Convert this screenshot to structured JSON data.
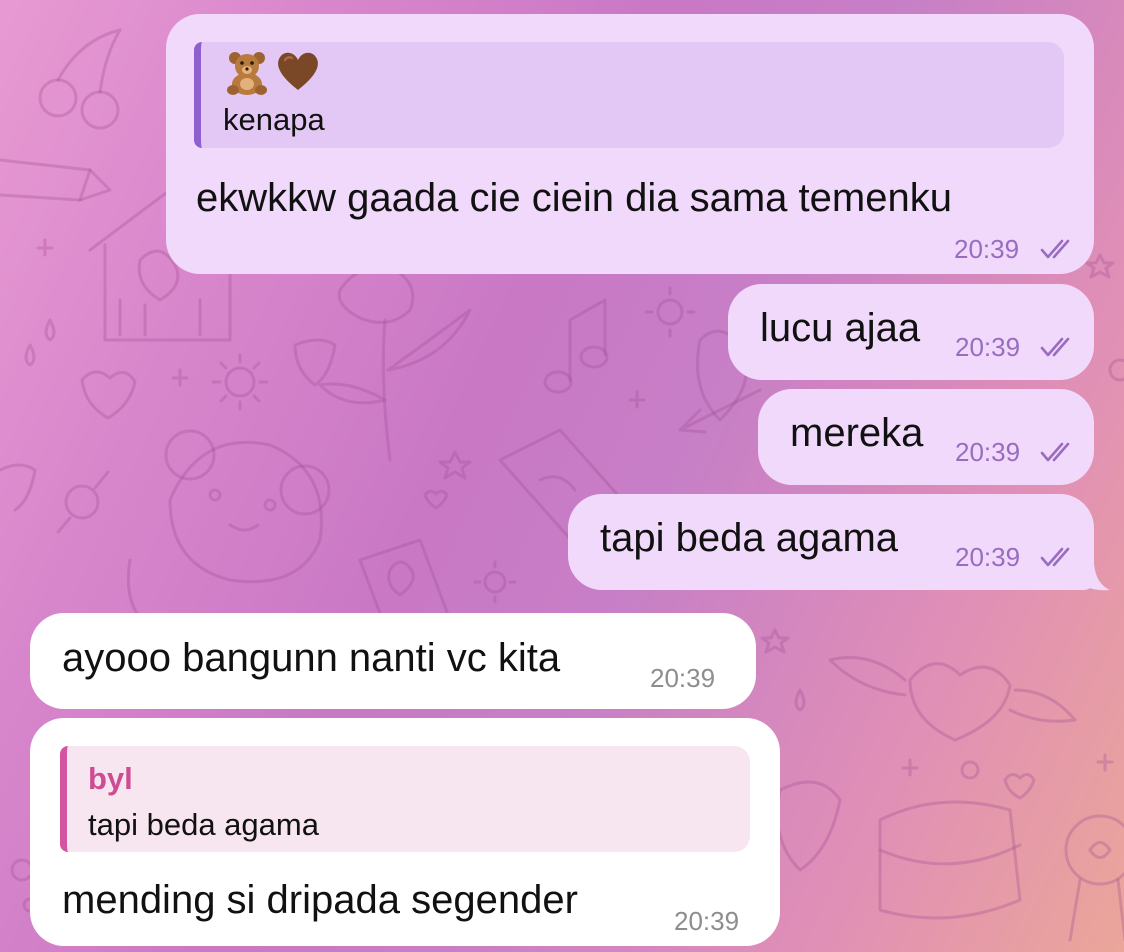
{
  "theme": {
    "outgoing_bubble": "#f0d9fb",
    "incoming_bubble": "#ffffff",
    "outgoing_time_color": "#9a6cc0",
    "incoming_time_color": "#8d8d8d",
    "reply_bar_outgoing": "#8e5fcf",
    "reply_bar_incoming": "#d4559f",
    "wallpaper_start": "#e79ad2",
    "wallpaper_end": "#eba699"
  },
  "messages": [
    {
      "direction": "outgoing",
      "reply": {
        "emoji": [
          "teddy-bear-icon",
          "brown-heart-icon"
        ],
        "text": "kenapa"
      },
      "text": "ekwkkw gaada cie ciein dia sama temenku",
      "time": "20:39",
      "status": "read"
    },
    {
      "direction": "outgoing",
      "text": "lucu ajaa",
      "time": "20:39",
      "status": "read"
    },
    {
      "direction": "outgoing",
      "text": "mereka",
      "time": "20:39",
      "status": "read"
    },
    {
      "direction": "outgoing",
      "text": "tapi beda agama",
      "time": "20:39",
      "status": "read"
    },
    {
      "direction": "incoming",
      "text": "ayooo bangunn nanti vc kita",
      "time": "20:39"
    },
    {
      "direction": "incoming",
      "reply": {
        "sender": "byl",
        "text": "tapi beda agama"
      },
      "text": "mending si dripada segender",
      "time": "20:39"
    }
  ]
}
